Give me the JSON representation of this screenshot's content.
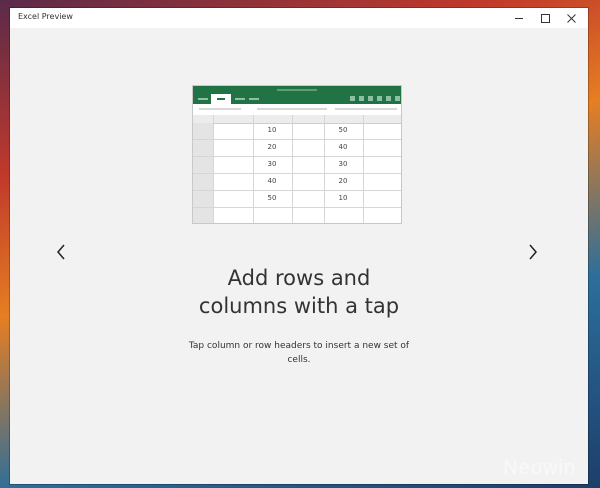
{
  "window": {
    "title": "Excel Preview"
  },
  "controls": {
    "minimize": "minimize",
    "maximize": "maximize",
    "close": "close"
  },
  "illustration": {
    "ribbon_color": "#217346",
    "rows": [
      [
        "10",
        "50"
      ],
      [
        "20",
        "40"
      ],
      [
        "30",
        "30"
      ],
      [
        "40",
        "20"
      ],
      [
        "50",
        "10"
      ]
    ]
  },
  "content": {
    "heading_line1": "Add rows and",
    "heading_line2": "columns with a tap",
    "description": "Tap column or row headers to insert a new set of cells."
  },
  "nav": {
    "prev_icon": "chevron-left-icon",
    "next_icon": "chevron-right-icon"
  },
  "watermark": "Neowin"
}
